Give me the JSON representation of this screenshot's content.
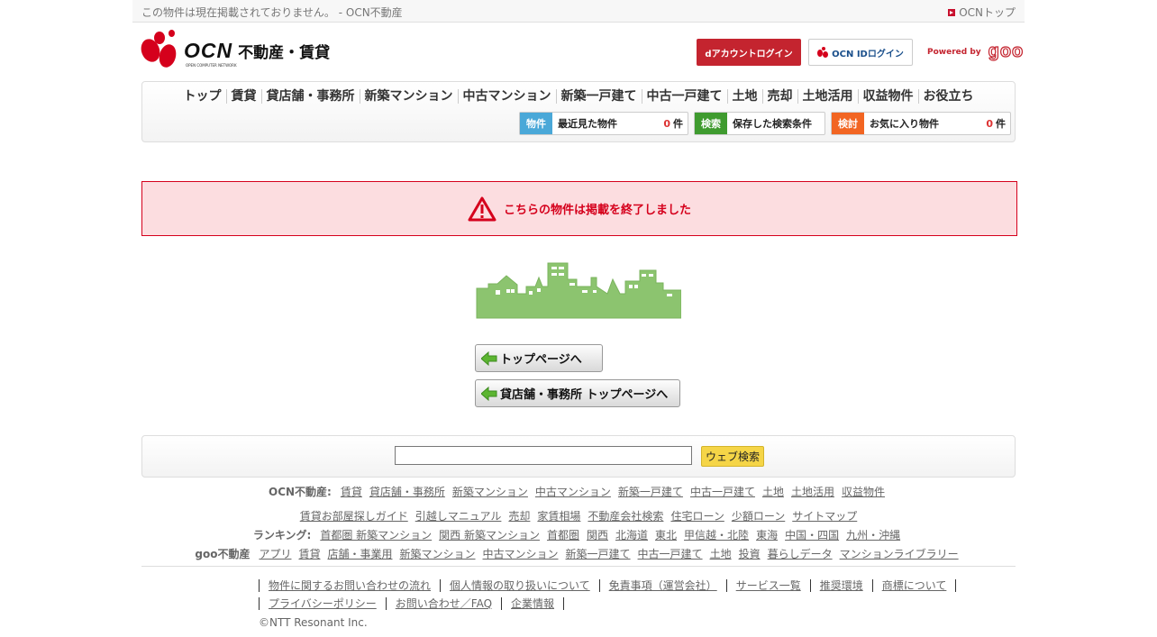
{
  "topbar": {
    "message": "この物件は現在掲載されておりません。 - OCN不動産",
    "ocn_top": "OCNトップ"
  },
  "header": {
    "logo_text": "OCN",
    "logo_sub": "OPEN COMPUTER NETWORK",
    "logo_jp": "不動産・賃貸",
    "d_login": "dアカウントログイン",
    "ocn_login": "OCN IDログイン",
    "powered_by": "Powered by",
    "goo": "goo"
  },
  "nav": {
    "items": [
      "トップ",
      "賃貸",
      "貸店舗・事務所",
      "新築マンション",
      "中古マンション",
      "新築一戸建て",
      "中古一戸建て",
      "土地",
      "売却",
      "土地活用",
      "収益物件",
      "お役立ち"
    ]
  },
  "counters": [
    {
      "tag": "物件",
      "label": "最近見た物件",
      "count": "0",
      "unit": "件",
      "color": "#4aa8d8"
    },
    {
      "tag": "検索",
      "label": "保存した検索条件",
      "count": "",
      "unit": "",
      "color": "#3f9b2f"
    },
    {
      "tag": "検討",
      "label": "お気に入り物件",
      "count": "0",
      "unit": "件",
      "color": "#f26522"
    }
  ],
  "alert": {
    "message": "こちらの物件は掲載を終了しました"
  },
  "buttons": {
    "top_page": "トップページへ",
    "shop_top_page": "貸店舗・事務所 トップページへ"
  },
  "search": {
    "value": "",
    "button": "ウェブ検索"
  },
  "links": {
    "ocn_head": "OCN不動産:",
    "ocn": [
      "賃貸",
      "貸店舗・事務所",
      "新築マンション",
      "中古マンション",
      "新築一戸建て",
      "中古一戸建て",
      "土地",
      "土地活用",
      "収益物件"
    ],
    "misc": [
      "賃貸お部屋探しガイド",
      "引越しマニュアル",
      "売却",
      "家賃相場",
      "不動産会社検索",
      "住宅ローン",
      "少額ローン",
      "サイトマップ"
    ],
    "ranking_head": "ランキング:",
    "ranking": [
      "首都圏 新築マンション",
      "関西 新築マンション",
      "首都圏",
      "関西",
      "北海道",
      "東北",
      "甲信越・北陸",
      "東海",
      "中国・四国",
      "九州・沖縄"
    ],
    "goo_head": "goo不動産",
    "goo": [
      "アプリ",
      "賃貸",
      "店舗・事業用",
      "新築マンション",
      "中古マンション",
      "新築一戸建て",
      "中古一戸建て",
      "土地",
      "投資",
      "暮らしデータ",
      "マンションライブラリー"
    ]
  },
  "footer": {
    "row1": [
      "物件に関するお問い合わせの流れ",
      "個人情報の取り扱いについて",
      "免責事項（運営会社）",
      "サービス一覧",
      "推奨環境",
      "商標について"
    ],
    "row2": [
      "プライバシーポリシー",
      "お問い合わせ／FAQ",
      "企業情報"
    ],
    "copyright": "©NTT Resonant Inc."
  },
  "colors": {
    "brand_red": "#d5001c",
    "alert_bg": "#fcdde0",
    "city_green": "#8cc46f",
    "search_button": "#f5d547"
  }
}
